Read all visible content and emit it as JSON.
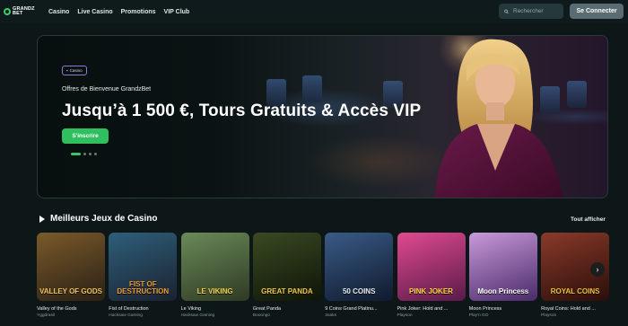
{
  "brand": {
    "line1": "GRANDZ",
    "line2": "BET"
  },
  "nav": [
    "Casino",
    "Live Casino",
    "Promotions",
    "VIP Club"
  ],
  "search": {
    "placeholder": "Rechercher"
  },
  "connect_label": "Se Connecter",
  "hero": {
    "badge": "Casino",
    "subtitle": "Offres de Bienvenue GrandzBet",
    "title": "Jusqu’à 1 500 €, Tours Gratuits & Accès VIP",
    "cta": "S'inscrire",
    "slides": 4,
    "active_slide": 1
  },
  "section": {
    "title": "Meilleurs Jeux de Casino",
    "see_all": "Tout afficher"
  },
  "games": [
    {
      "name": "Valley of the Gods",
      "provider": "Yggdrasil",
      "art": "VALLEY OF GODS",
      "bg1": "#7a5a2a",
      "bg2": "#2a2016",
      "fg": "#f1c45a"
    },
    {
      "name": "Fist of Destruction",
      "provider": "Hacksaw Gaming",
      "art": "FIST OF DESTRUCTION",
      "bg1": "#2e5f7a",
      "bg2": "#1b2230",
      "fg": "#f09a30"
    },
    {
      "name": "Le Viking",
      "provider": "Hacksaw Gaming",
      "art": "LE VIKING",
      "bg1": "#6a8a58",
      "bg2": "#2f3a24",
      "fg": "#f3d34a"
    },
    {
      "name": "Great Panda",
      "provider": "Booongo",
      "art": "GREAT PANDA",
      "bg1": "#3b4a22",
      "bg2": "#0e1408",
      "fg": "#f2c84a"
    },
    {
      "name": "9 Coins Grand Platinu...",
      "provider": "3oaks",
      "art": "50 COINS",
      "bg1": "#3a5b86",
      "bg2": "#0f1a2e",
      "fg": "#e8eef6"
    },
    {
      "name": "Pink Joker: Hold and ...",
      "provider": "Playson",
      "art": "PINK JOKER",
      "bg1": "#e04a90",
      "bg2": "#5a1a4a",
      "fg": "#ffd640"
    },
    {
      "name": "Moon Princess",
      "provider": "Play'n GO",
      "art": "Moon Princess",
      "bg1": "#c89ad8",
      "bg2": "#4a2a6a",
      "fg": "#ffffff"
    },
    {
      "name": "Royal Coins: Hold and ...",
      "provider": "Playson",
      "art": "ROYAL COINS",
      "bg1": "#8a3a2a",
      "bg2": "#2a0e0a",
      "fg": "#f3c23a"
    }
  ],
  "colors": {
    "accent": "#2fbf5e",
    "bg": "#0d1718"
  }
}
